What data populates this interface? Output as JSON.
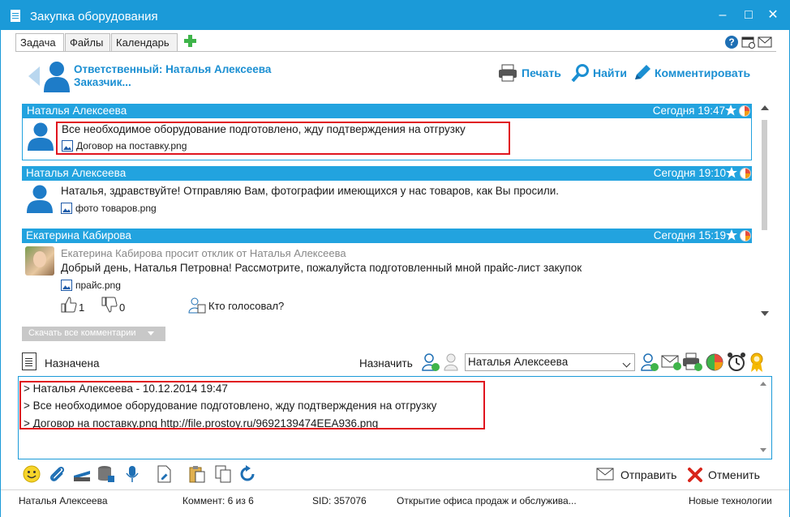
{
  "window": {
    "title": "Закупка оборудования"
  },
  "tabs": [
    {
      "label": "Задача"
    },
    {
      "label": "Файлы"
    },
    {
      "label": "Календарь"
    }
  ],
  "header": {
    "responsible": "Ответственный: Наталья Алексеева",
    "customer": "Заказчик...",
    "actions": {
      "print": "Печать",
      "find": "Найти",
      "comment": "Комментировать"
    }
  },
  "messages": [
    {
      "author": "Наталья Алексеева",
      "time": "Сегодня 19:47",
      "text": "Все необходимое оборудование подготовлено, жду подтверждения на отгрузку",
      "attachment": "Договор на поставку.png"
    },
    {
      "author": "Наталья Алексеева",
      "time": "Сегодня 19:10",
      "text": "Наталья, здравствуйте! Отправляю Вам, фотографии имеющихся у нас товаров, как Вы просили.",
      "attachment": "фото товаров.png"
    },
    {
      "author": "Екатерина Кабирова",
      "time": "Сегодня 15:19",
      "sub": "Екатерина Кабирова просит отклик от Наталья Алексеева",
      "text": "Добрый день, Наталья Петровна! Рассмотрите, пожалуйста подготовленный мной прайс-лист закупок",
      "attachment": "прайс.png",
      "likes": "1",
      "dislikes": "0",
      "who_voted": "Кто голосовал?"
    }
  ],
  "download_all": "Скачать все комментарии",
  "status": {
    "state": "Назначена",
    "assign_label": "Назначить",
    "assignee": "Наталья Алексеева"
  },
  "editor": {
    "lines": [
      "> Наталья Алексеева - 10.12.2014 19:47",
      "> Все необходимое оборудование подготовлено, жду подтверждения на отгрузку",
      "> Договор на поставку.png http://file.prostoy.ru/9692139474EEA936.png"
    ]
  },
  "buttons": {
    "send": "Отправить",
    "cancel": "Отменить"
  },
  "statusbar": {
    "user": "Наталья Алексеева",
    "comments": "Коммент: 6 из 6",
    "sid": "SID: 357076",
    "project": "Открытие офиса продаж и обслужива...",
    "company": "Новые технологии"
  },
  "colors": {
    "accent": "#1b9ad8",
    "header_bar": "#22a3df",
    "link": "#1b8fd2",
    "highlight": "#e0141e"
  }
}
